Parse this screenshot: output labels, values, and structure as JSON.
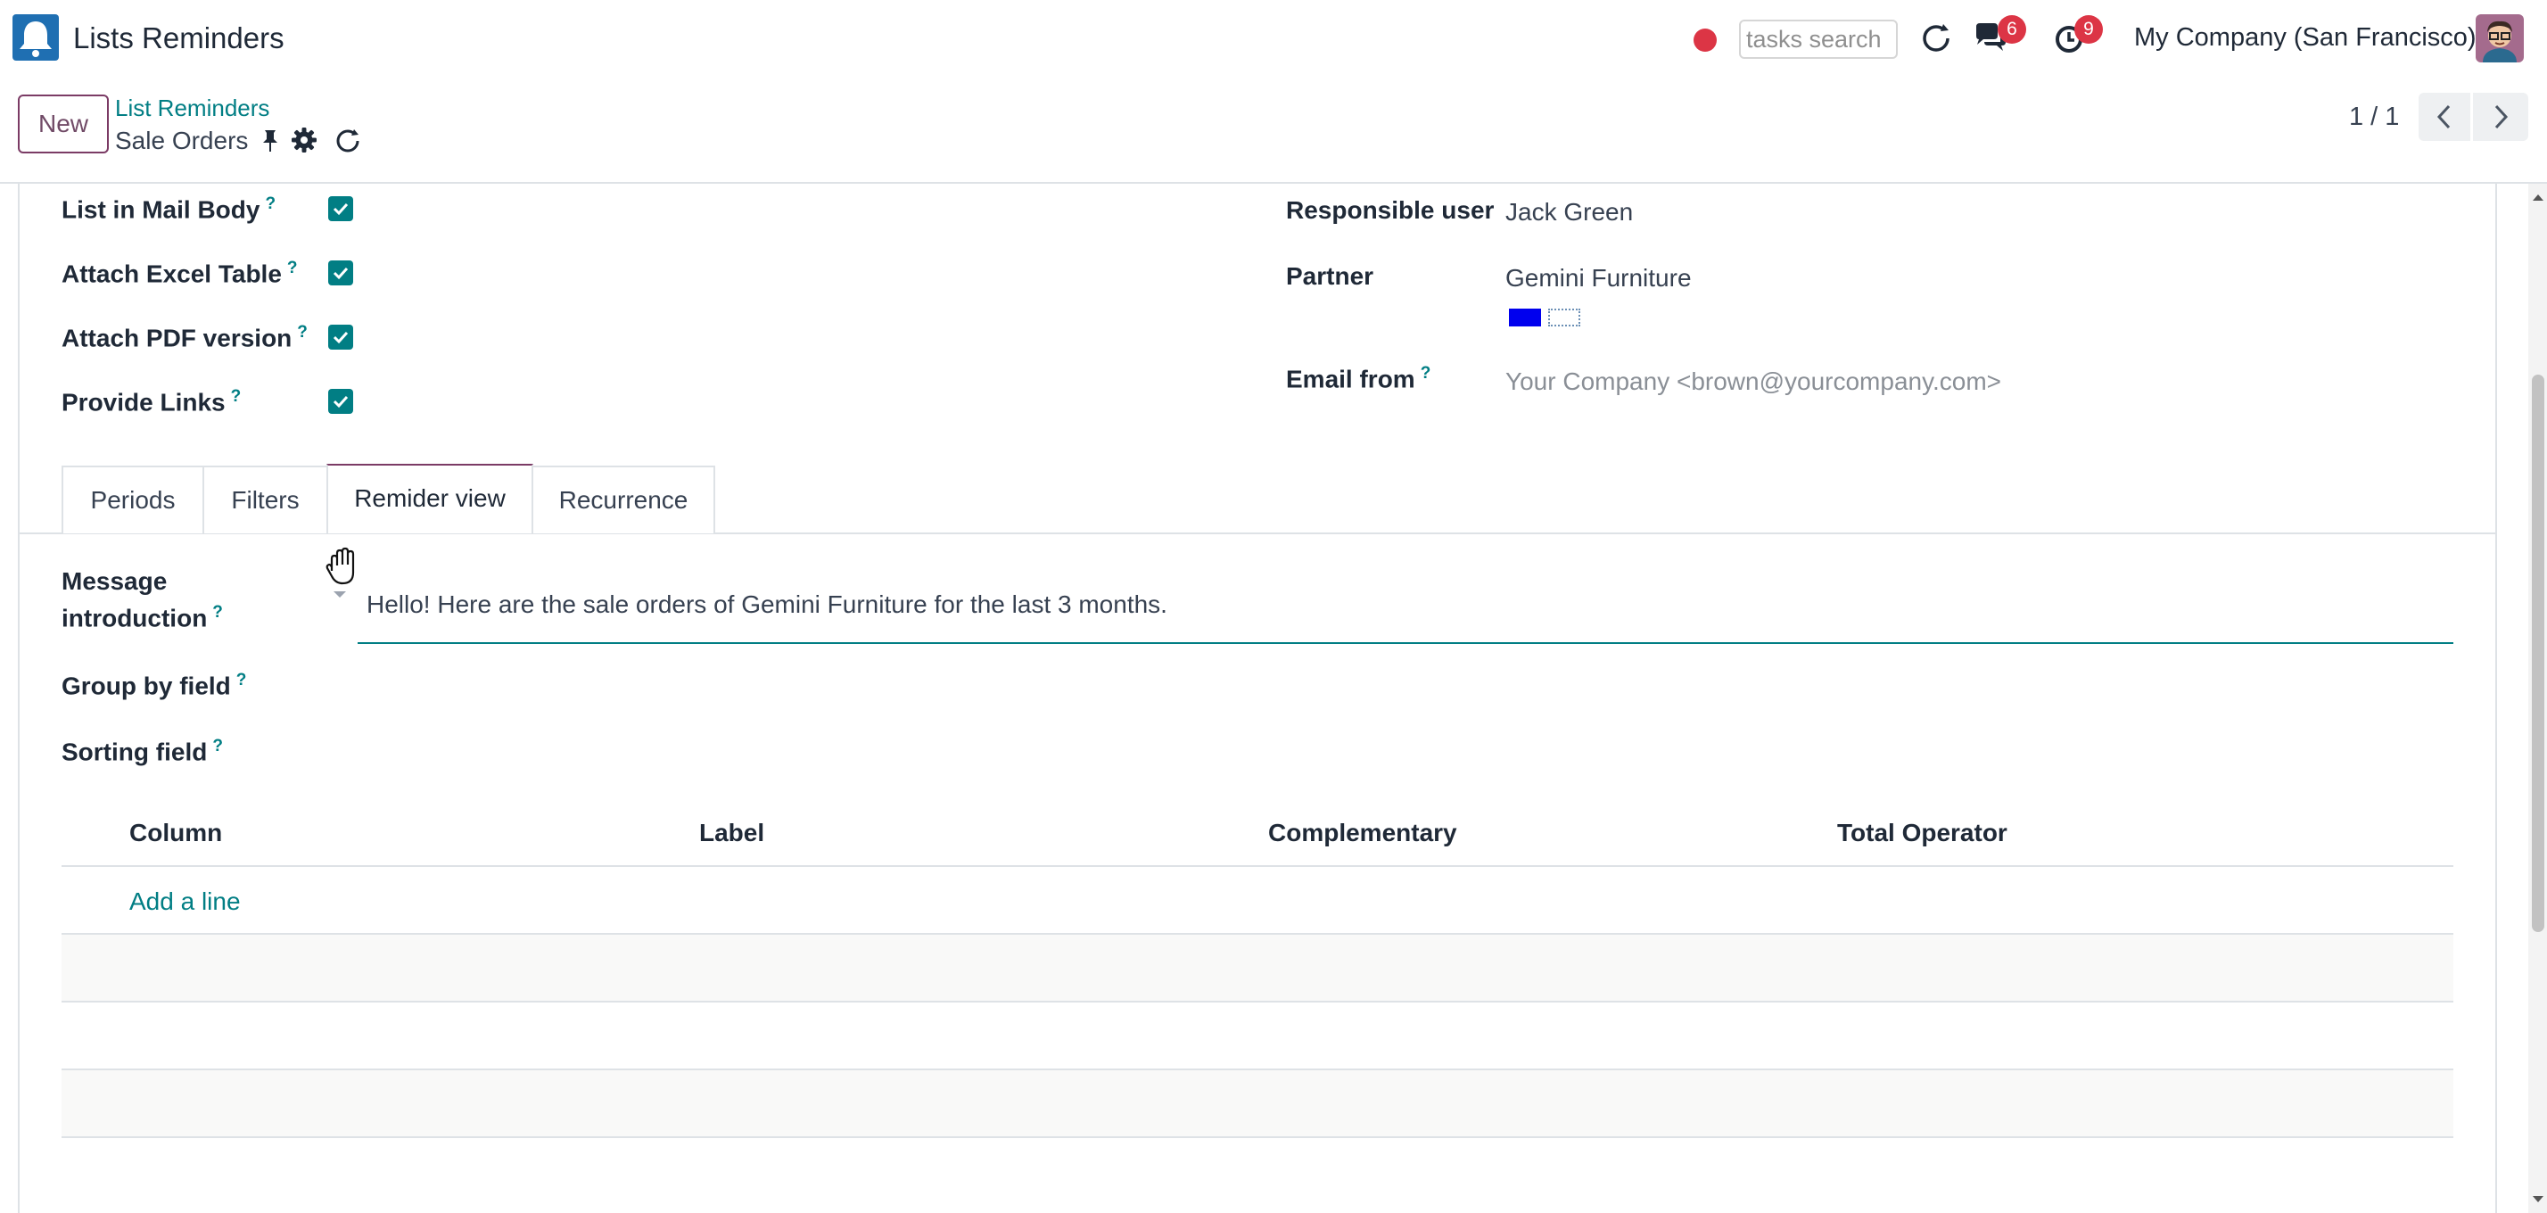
{
  "navbar": {
    "app_name": "Lists Reminders",
    "search_placeholder": "tasks search",
    "chat_count": "6",
    "activity_count": "9",
    "company": "My Company (San Francisco)"
  },
  "control_panel": {
    "new_label": "New",
    "breadcrumb_parent": "List Reminders",
    "breadcrumb_current": "Sale Orders",
    "pager_value": "1 / 1"
  },
  "form": {
    "left_fields": [
      {
        "label": "List in Mail Body",
        "help": "?",
        "checked": true
      },
      {
        "label": "Attach Excel Table",
        "help": "?",
        "checked": true
      },
      {
        "label": "Attach PDF version",
        "help": "?",
        "checked": true
      },
      {
        "label": "Provide Links",
        "help": "?",
        "checked": true
      }
    ],
    "responsible_user_label": "Responsible user",
    "responsible_user_value": "Jack Green",
    "partner_label": "Partner",
    "partner_value": "Gemini Furniture",
    "email_from_label": "Email from",
    "email_from_help": "?",
    "email_from_placeholder": "Your Company <brown@yourcompany.com>"
  },
  "tabs": [
    {
      "label": "Periods",
      "active": false
    },
    {
      "label": "Filters",
      "active": false
    },
    {
      "label": "Remider view",
      "active": true
    },
    {
      "label": "Recurrence",
      "active": false
    }
  ],
  "reminder_view": {
    "message_label_line1": "Message",
    "message_label_line2": "introduction",
    "message_help": "?",
    "message_value": "Hello! Here are the sale orders of Gemini Furniture for the last 3 months.",
    "group_by_label": "Group by field",
    "group_by_help": "?",
    "sorting_label": "Sorting field",
    "sorting_help": "?"
  },
  "table": {
    "columns": [
      "Column",
      "Label",
      "Complementary",
      "Total Operator"
    ],
    "add_line_label": "Add a line"
  },
  "colors": {
    "brand": "#714B67",
    "accent": "#017e84",
    "badge": "#dc3545",
    "tag_blue": "#0000ee"
  }
}
